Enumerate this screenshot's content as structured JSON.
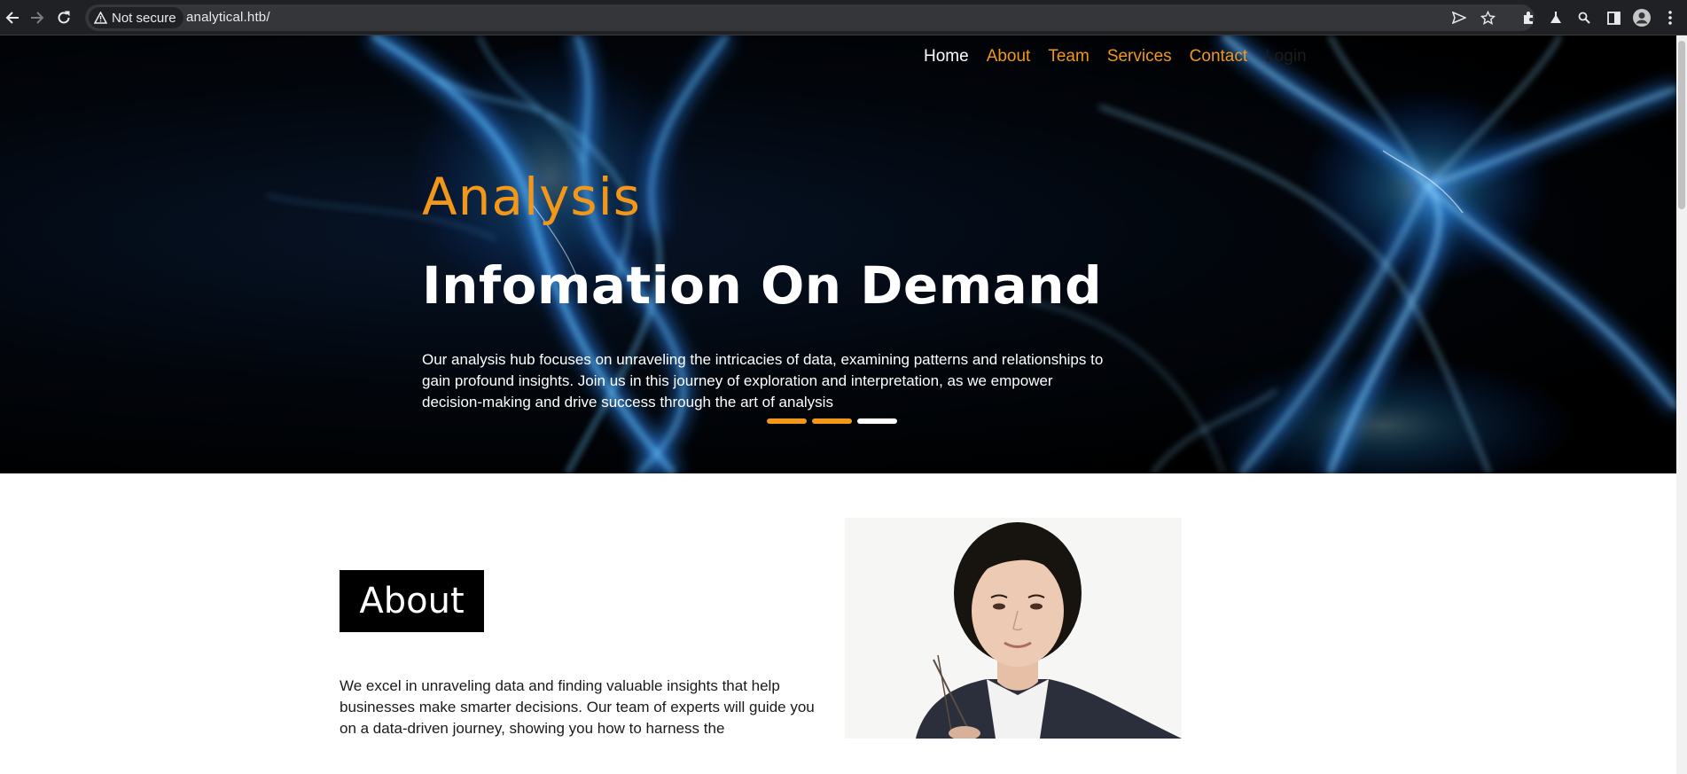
{
  "browser": {
    "security_label": "Not secure",
    "url": "analytical.htb/",
    "icons": [
      "back-arrow-icon",
      "forward-arrow-icon",
      "reload-icon",
      "warning-icon",
      "send-icon",
      "star-icon",
      "extensions-icon",
      "flask-icon",
      "zoom-icon",
      "side-panel-icon",
      "profile-icon",
      "menu-dots-icon"
    ]
  },
  "nav": {
    "items": [
      {
        "label": "Home"
      },
      {
        "label": "About"
      },
      {
        "label": "Team"
      },
      {
        "label": "Services"
      },
      {
        "label": "Contact"
      },
      {
        "label": "Login"
      }
    ]
  },
  "hero": {
    "subtitle": "Analysis",
    "title": "Infomation On Demand",
    "text": "Our analysis hub focuses on unraveling the intricacies of data, examining patterns and relationships to gain profound insights. Join us in this journey of exploration and interpretation, as we empower decision-making and drive success through the art of analysis",
    "slides": 3,
    "active_slide": 3
  },
  "about": {
    "heading": "About",
    "text": "We excel in unraveling data and finding valuable insights that help businesses make smarter decisions. Our team of experts will guide you on a data-driven journey, showing you how to harness the"
  },
  "colors": {
    "accent": "#f29719",
    "hero_bg": "#000000",
    "text_dark": "#1a1a1a"
  }
}
